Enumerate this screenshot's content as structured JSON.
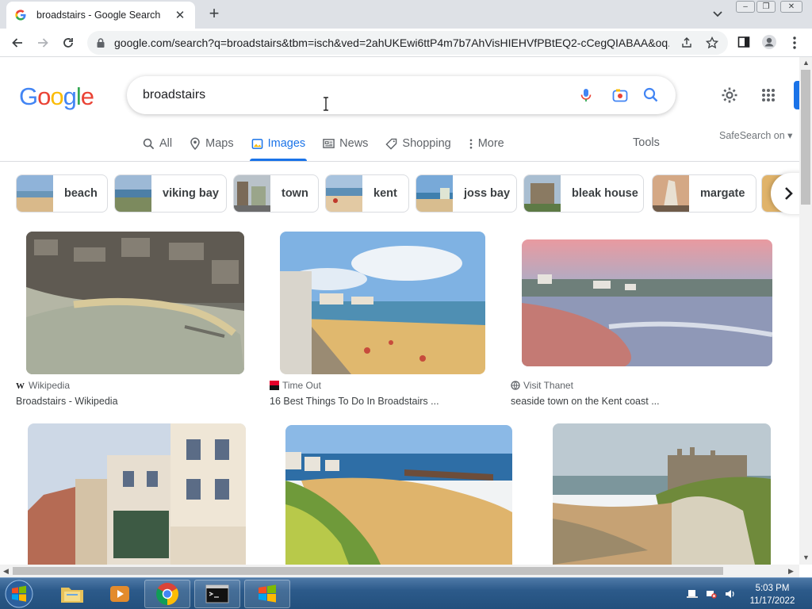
{
  "browser": {
    "tab_title": "broadstairs - Google Search",
    "tab_close": "✕",
    "new_tab": "+",
    "url": "google.com/search?q=broadstairs&tbm=isch&ved=2ahUKEwi6ttP4m7b7AhVisHIEHVfPBtEQ2-cCegQIABAA&oq...",
    "window_controls": [
      "–",
      "❐",
      "✕"
    ]
  },
  "google": {
    "logo_letters": [
      "G",
      "o",
      "o",
      "g",
      "l",
      "e"
    ],
    "query": "broadstairs",
    "tabs": [
      {
        "label": "All",
        "icon": "search-icon"
      },
      {
        "label": "Maps",
        "icon": "map-pin-icon"
      },
      {
        "label": "Images",
        "icon": "image-icon",
        "active": true
      },
      {
        "label": "News",
        "icon": "news-icon"
      },
      {
        "label": "Shopping",
        "icon": "tag-icon"
      },
      {
        "label": "More",
        "icon": "more-vert-icon"
      }
    ],
    "tools_label": "Tools",
    "safesearch_label": "SafeSearch on ▾"
  },
  "chips": [
    {
      "label": "beach"
    },
    {
      "label": "viking bay"
    },
    {
      "label": "town"
    },
    {
      "label": "kent"
    },
    {
      "label": "joss bay"
    },
    {
      "label": "bleak house"
    },
    {
      "label": "margate"
    }
  ],
  "results": [
    {
      "source": "Wikipedia",
      "title": "Broadstairs - Wikipedia",
      "source_icon": "wikipedia-icon"
    },
    {
      "source": "Time Out",
      "title": "16 Best Things To Do In Broadstairs ...",
      "source_icon": "timeout-icon"
    },
    {
      "source": "Visit Thanet",
      "title": "seaside town on the Kent coast ...",
      "source_icon": "globe-icon"
    },
    {
      "source": "",
      "title": "",
      "source_icon": ""
    },
    {
      "source": "",
      "title": "",
      "source_icon": ""
    },
    {
      "source": "",
      "title": "",
      "source_icon": ""
    }
  ],
  "taskbar": {
    "clock_time": "5:03 PM",
    "clock_date": "11/17/2022"
  }
}
